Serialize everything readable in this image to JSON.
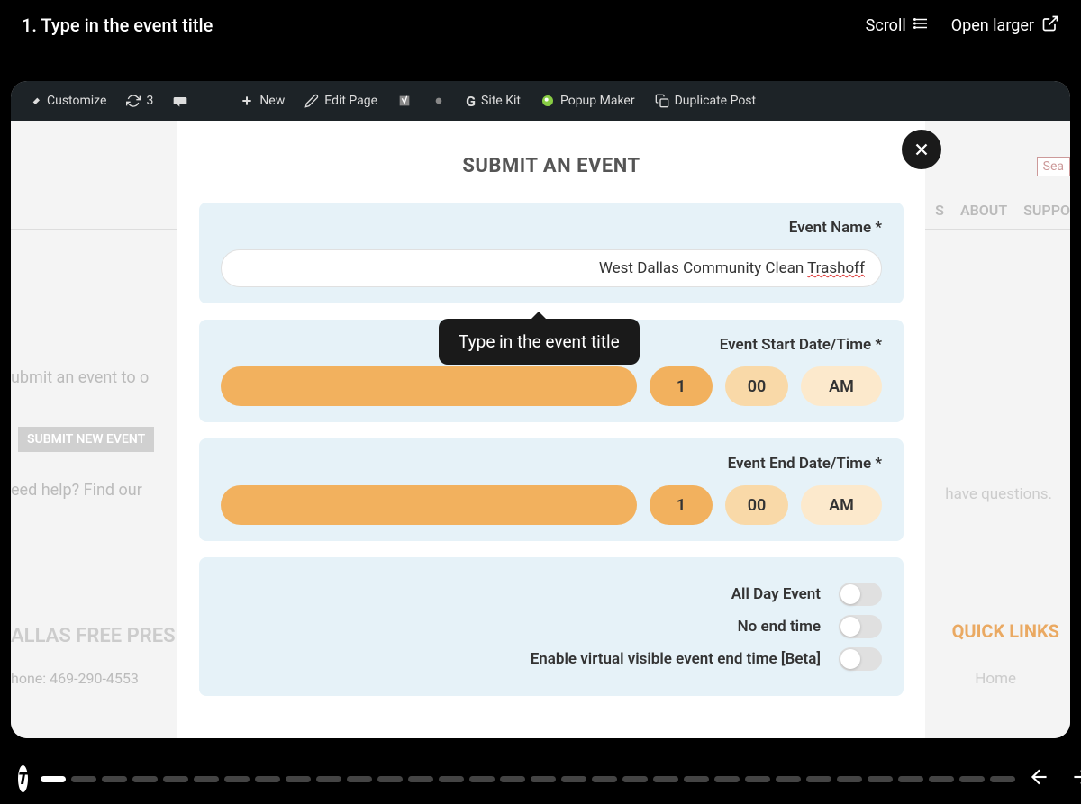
{
  "header": {
    "step_title": "1. Type in the event title",
    "scroll_label": "Scroll",
    "open_larger_label": "Open larger"
  },
  "admin_bar": {
    "customize": "Customize",
    "updates_count": "3",
    "new_label": "New",
    "edit_page": "Edit Page",
    "site_kit": "Site Kit",
    "popup_maker": "Popup Maker",
    "duplicate_post": "Duplicate Post"
  },
  "background": {
    "submit_text": "ubmit an event to o",
    "submit_btn": "SUBMIT NEW EVENT",
    "need_help": "eed help? Find our",
    "footer_title": "ALLAS FREE PRES",
    "phone": "hone: 469-290-4553",
    "search_placeholder": "Sea",
    "nav_about": "ABOUT",
    "nav_suppo": "SUPPO",
    "nav_s": "S",
    "questions": "have questions.",
    "quick_links": "QUICK LINKS",
    "home": "Home"
  },
  "modal": {
    "title": "SUBMIT AN EVENT",
    "event_name_label": "Event Name *",
    "event_name_value_pre": "West Dallas Community Clean ",
    "event_name_value_misspell": "Trashoff",
    "start_label": "Event Start Date/Time *",
    "end_label": "Event End Date/Time *",
    "start": {
      "hour": "1",
      "minute": "00",
      "ampm": "AM"
    },
    "end": {
      "hour": "1",
      "minute": "00",
      "ampm": "AM"
    },
    "all_day_label": "All Day Event",
    "no_end_label": "No end time",
    "virtual_label": "Enable virtual visible event end time [Beta]"
  },
  "tooltip": {
    "text": "Type in the event title"
  },
  "progress": {
    "total_segments": 32,
    "active_index": 0
  }
}
